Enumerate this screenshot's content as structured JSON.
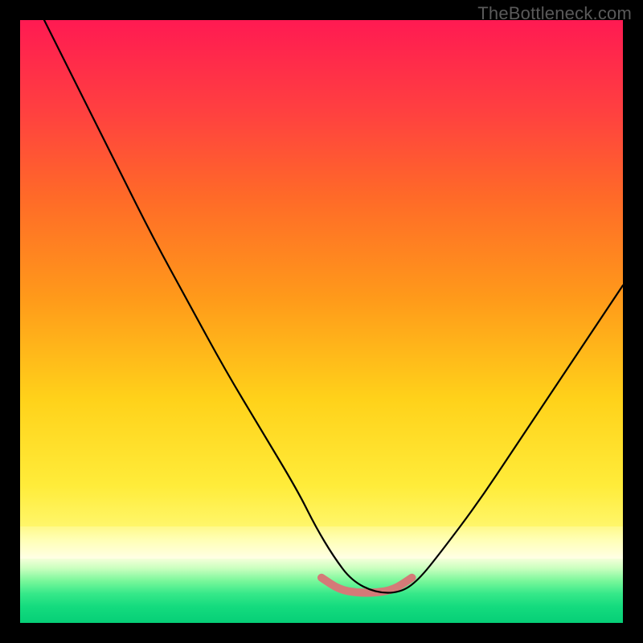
{
  "watermark": "TheBottleneck.com",
  "chart_data": {
    "type": "line",
    "title": "",
    "xlabel": "",
    "ylabel": "",
    "xlim": [
      0,
      100
    ],
    "ylim": [
      0,
      100
    ],
    "grid": false,
    "legend": false,
    "bands": [
      {
        "name": "red-yellow-gradient",
        "y_from": 100,
        "y_to": 16
      },
      {
        "name": "pale-band",
        "y_from": 16,
        "y_to": 10.7
      },
      {
        "name": "green-gradient",
        "y_from": 10.7,
        "y_to": 0
      }
    ],
    "series": [
      {
        "name": "bottleneck-curve",
        "stroke": "#000000",
        "x": [
          4,
          10,
          16,
          22,
          28,
          34,
          40,
          46,
          49,
          52,
          55,
          59,
          63,
          66,
          70,
          76,
          82,
          88,
          94,
          100
        ],
        "values": [
          100,
          88,
          76,
          64,
          53,
          42,
          32,
          22,
          16,
          11,
          7,
          5,
          5,
          7,
          12,
          20,
          29,
          38,
          47,
          56
        ]
      },
      {
        "name": "trough-highlight",
        "stroke": "#d47a78",
        "stroke_width": 10,
        "x": [
          50,
          53,
          56,
          59,
          62,
          65
        ],
        "values": [
          7.5,
          5.5,
          5,
          5,
          5.5,
          7.5
        ]
      }
    ]
  }
}
